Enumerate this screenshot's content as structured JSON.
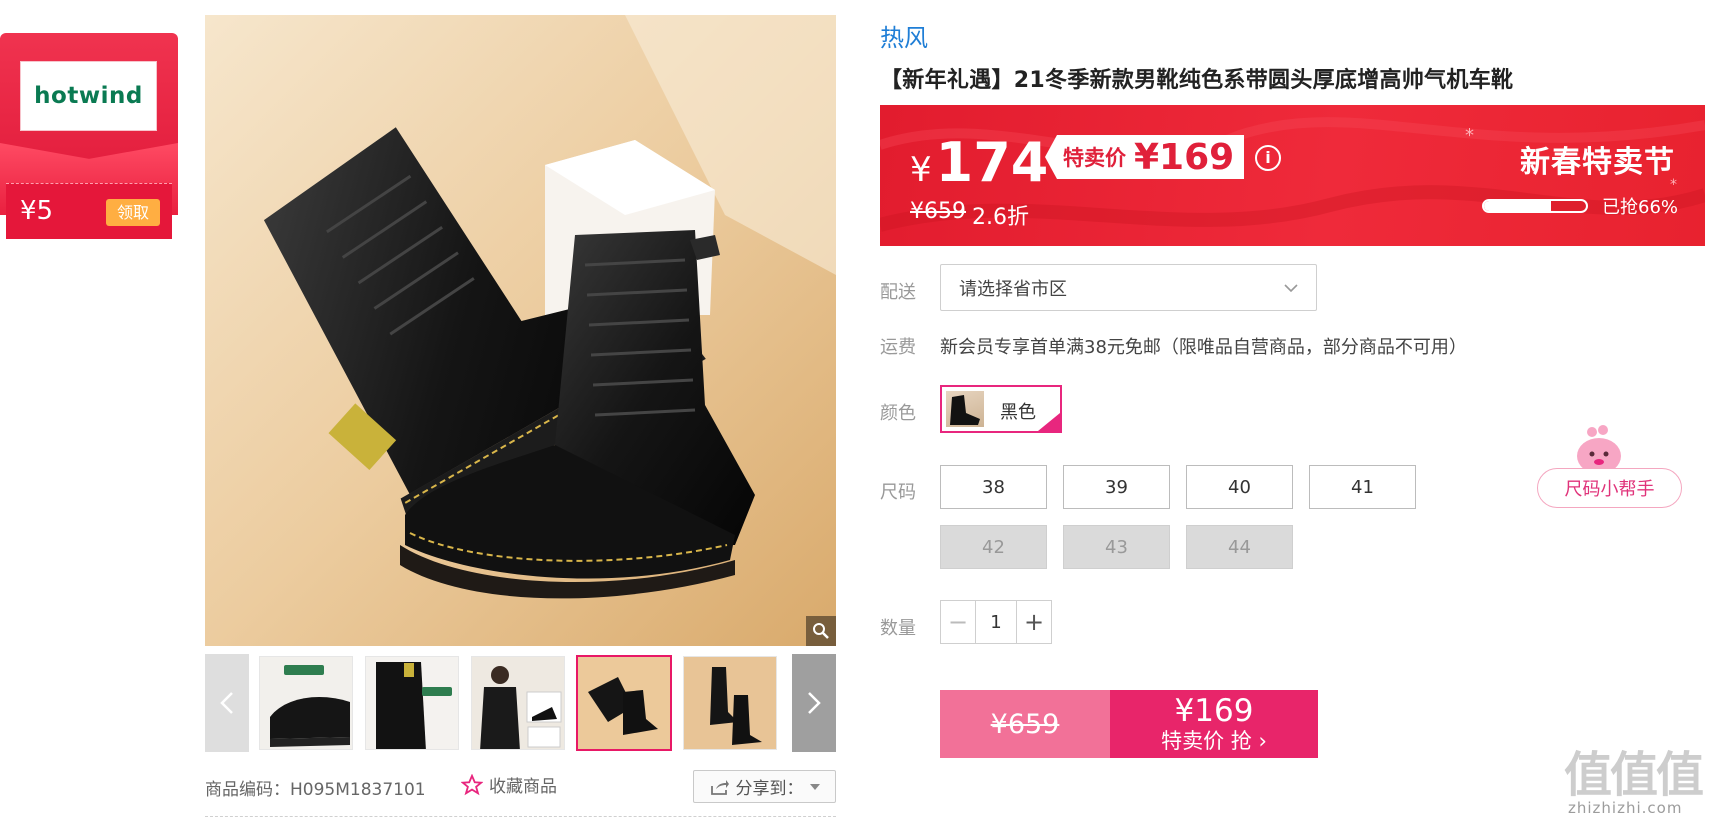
{
  "coupon": {
    "brand_logo": "hotwind",
    "amount": "¥5",
    "claim_label": "领取"
  },
  "gallery": {
    "thumbnail_count": 6,
    "active_thumbnail": 4,
    "thumbnails": [
      {
        "badge": "",
        "icon": "shoe-side"
      },
      {
        "badge": "",
        "icon": "shoe-back"
      },
      {
        "badge": "",
        "icon": "model-outfit"
      },
      {
        "badge": "",
        "icon": "boots-pair"
      },
      {
        "badge": "",
        "icon": "boots-pair-standing"
      }
    ]
  },
  "item_meta": {
    "code_label": "商品编码：H095M1837101",
    "favorite_label": "收藏商品",
    "share_label": "分享到："
  },
  "product": {
    "brand": "热风",
    "title": "【新年礼遇】21冬季新款男靴纯色系带圆头厚底增高帅气机车靴"
  },
  "price": {
    "currency": "¥",
    "current": "174",
    "special_label": "特卖价",
    "special_value": "¥169",
    "original": "¥659",
    "discount": "2.6折",
    "festival_label": "新春特卖节",
    "sold_percent": 0.66,
    "sold_text": "已抢66%"
  },
  "delivery": {
    "label": "配送",
    "placeholder": "请选择省市区"
  },
  "shipping": {
    "label": "运费",
    "text": "新会员专享首单满38元免邮（限唯品自营商品，部分商品不可用）"
  },
  "color": {
    "label": "颜色",
    "selected": "黑色"
  },
  "size": {
    "label": "尺码",
    "options": [
      {
        "value": "38",
        "available": true
      },
      {
        "value": "39",
        "available": true
      },
      {
        "value": "40",
        "available": true
      },
      {
        "value": "41",
        "available": true
      },
      {
        "value": "42",
        "available": false
      },
      {
        "value": "43",
        "available": false
      },
      {
        "value": "44",
        "available": false
      }
    ],
    "helper_label": "尺码小帮手"
  },
  "quantity": {
    "label": "数量",
    "value": "1",
    "minus": "−",
    "plus": "+"
  },
  "buy": {
    "original": "¥659",
    "price": "¥169",
    "action": "特卖价 抢 ›"
  },
  "watermark": {
    "logo": "值值值",
    "text": "zhizhizhi.com"
  },
  "colors": {
    "accent_pink": "#e8256a",
    "banner_red": "#e21c2e",
    "brand_blue": "#1f7ed6",
    "logo_green": "#0a7a52"
  }
}
